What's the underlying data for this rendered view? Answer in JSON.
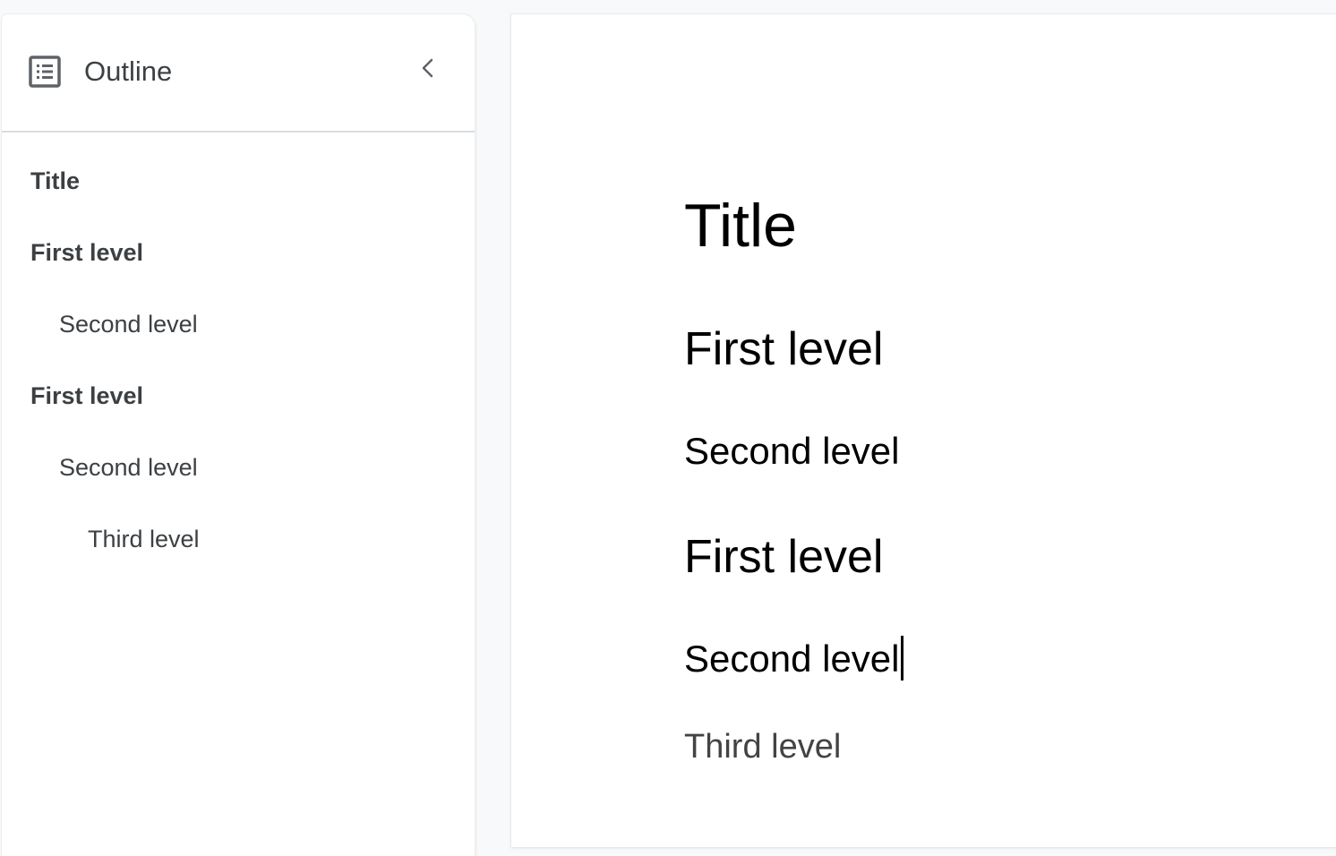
{
  "outline": {
    "title": "Outline",
    "icon": "outline-list-icon",
    "collapse_icon": "chevron-left-icon",
    "items": [
      {
        "label": "Title",
        "level": 0
      },
      {
        "label": "First level",
        "level": 1
      },
      {
        "label": "Second level",
        "level": 2
      },
      {
        "label": "First level",
        "level": 1
      },
      {
        "label": "Second level",
        "level": 2
      },
      {
        "label": "Third level",
        "level": 3
      }
    ]
  },
  "document": {
    "lines": [
      {
        "text": "Title",
        "style": "title"
      },
      {
        "text": "First level",
        "style": "heading-1"
      },
      {
        "text": "Second level",
        "style": "heading-2"
      },
      {
        "text": "First level",
        "style": "heading-1"
      },
      {
        "text": "Second level",
        "style": "heading-2"
      },
      {
        "text": "Third level",
        "style": "heading-3"
      }
    ]
  },
  "colors": {
    "background": "#f8f9fa",
    "outline_text": "#3c4043",
    "document_text": "#000000",
    "heading3_text": "#434343",
    "divider": "#dadce0"
  }
}
